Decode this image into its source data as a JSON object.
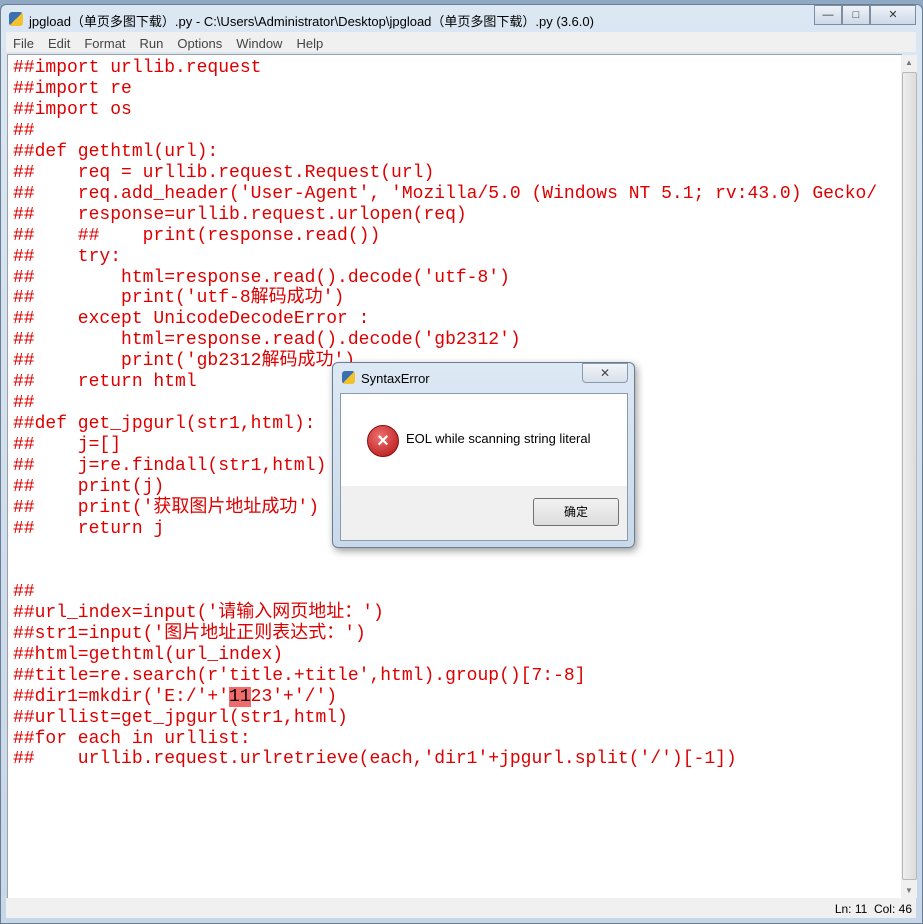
{
  "window": {
    "title": "jpgload（单页多图下载）.py - C:\\Users\\Administrator\\Desktop\\jpgload（单页多图下载）.py (3.6.0)",
    "minimize": "—",
    "maximize": "□",
    "close": "✕"
  },
  "menu": [
    "File",
    "Edit",
    "Format",
    "Run",
    "Options",
    "Window",
    "Help"
  ],
  "code": {
    "lines_before": [
      "##import urllib.request",
      "##import re",
      "##import os",
      "##",
      "##def gethtml(url):",
      "##    req = urllib.request.Request(url)",
      "##    req.add_header('User-Agent', 'Mozilla/5.0 (Windows NT 5.1; rv:43.0) Gecko/",
      "##    response=urllib.request.urlopen(req)",
      "##    ##    print(response.read())",
      "##    try:",
      "##        html=response.read().decode('utf-8')",
      "##        print('utf-8解码成功')",
      "##    except UnicodeDecodeError :",
      "##        html=response.read().decode('gb2312')",
      "##        print('gb2312解码成功')",
      "##    return html",
      "##",
      "##def get_jpgurl(str1,html):",
      "##    j=[]",
      "##    j=re.findall(str1,html)",
      "##    print(j)",
      "##    print('获取图片地址成功')",
      "##    return j",
      "",
      "",
      "##",
      "##url_index=input('请输入网页地址：')",
      "##str1=input('图片地址正则表达式：')",
      "##html=gethtml(url_index)",
      "##title=re.search(r'title.+title',html).group()[7:-8]"
    ],
    "error_line_pre": "##dir1=mkdir('E:/'+'",
    "error_line_hl": "11",
    "error_line_post": "23'+'/')",
    "lines_after": [
      "##urllist=get_jpgurl(str1,html)",
      "##for each in urllist:",
      "##    urllib.request.urlretrieve(each,'dir1'+jpgurl.split('/')[-1])"
    ]
  },
  "status": {
    "position": "Ln: 11  Col: 46"
  },
  "dialog": {
    "title": "SyntaxError",
    "message": "EOL while scanning string literal",
    "ok": "确定",
    "close": "✕",
    "icon": "error-icon"
  },
  "colors": {
    "code": "#dd0000",
    "highlight": "#f06b6b"
  }
}
